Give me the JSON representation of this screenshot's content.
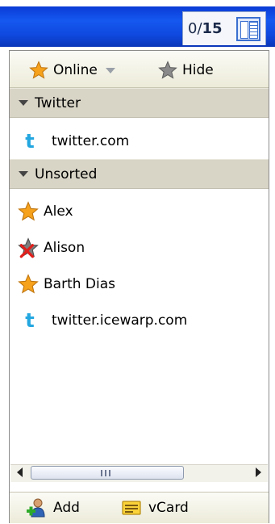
{
  "header": {
    "counter_current": "0/",
    "counter_total": "15",
    "layout_icon": "columns-layout-icon"
  },
  "toolbar": {
    "status_label": "Online",
    "status_icon": "star-icon",
    "hide_label": "Hide",
    "hide_icon": "gray-star-icon"
  },
  "groups": [
    {
      "name": "Twitter",
      "contacts": [
        {
          "label": "twitter.com",
          "icon": "twitter-icon"
        }
      ]
    },
    {
      "name": "Unsorted",
      "contacts": [
        {
          "label": "Alex",
          "icon": "star-icon"
        },
        {
          "label": "Alison",
          "icon": "offline-star-icon"
        },
        {
          "label": "Barth Dias",
          "icon": "star-icon"
        },
        {
          "label": "twitter.icewarp.com",
          "icon": "twitter-icon"
        }
      ]
    }
  ],
  "bottom": {
    "add_label": "Add",
    "add_icon": "add-user-icon",
    "vcard_label": "vCard",
    "vcard_icon": "vcard-icon"
  },
  "colors": {
    "header_blue": "#1558f0",
    "group_bg": "#d8d4c6",
    "twitter_blue": "#24a7e0",
    "star_orange": "#f7a51a"
  }
}
